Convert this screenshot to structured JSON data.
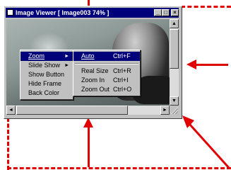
{
  "window": {
    "title": "Image Viewer [ Image003 74% ]",
    "minimize_glyph": "_",
    "maximize_glyph": "□",
    "close_glyph": "×"
  },
  "context_menu": {
    "items": [
      {
        "label": "Zoom",
        "has_submenu": true,
        "selected": true
      },
      {
        "label": "Slide Show",
        "has_submenu": true
      },
      {
        "label": "Show Button"
      },
      {
        "label": "Hide Frame"
      },
      {
        "label": "Back Color"
      }
    ]
  },
  "zoom_submenu": {
    "items": [
      {
        "label": "Auto",
        "shortcut": "Ctrl+F",
        "selected": true
      },
      {
        "label": "Real Size",
        "shortcut": "Ctrl+R"
      },
      {
        "label": "Zoom In",
        "shortcut": "Ctrl+I"
      },
      {
        "label": "Zoom Out",
        "shortcut": "Ctrl+O"
      }
    ]
  },
  "scroll_glyphs": {
    "up": "▲",
    "down": "▼",
    "left": "◄",
    "right": "►"
  },
  "colors": {
    "annotation": "#e00000",
    "titlebar": "#00007b",
    "menu_highlight": "#00007b"
  }
}
